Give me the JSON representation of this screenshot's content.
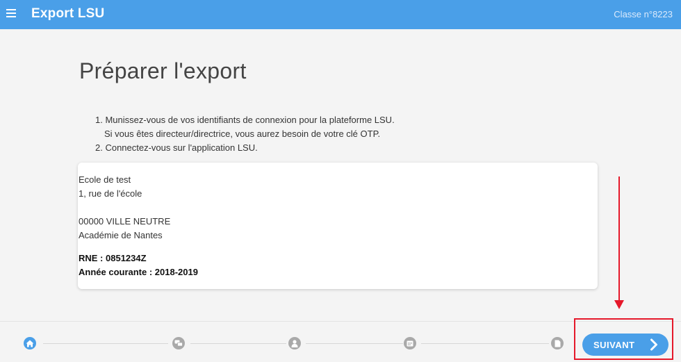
{
  "header": {
    "menu_icon": "hamburger-menu-icon",
    "title": "Export LSU",
    "class_label": "Classe n°8223"
  },
  "main": {
    "title": "Préparer l'export",
    "instructions": [
      "1. Munissez-vous de vos identifiants de connexion pour la plateforme LSU.",
      "Si vous êtes directeur/directrice, vous aurez besoin de votre clé OTP.",
      "2. Connectez-vous sur l'application LSU."
    ],
    "school": {
      "name": "Ecole de test",
      "address": "1, rue de l'école",
      "city": "00000 VILLE NEUTRE",
      "academy": "Académie de Nantes",
      "rne": "RNE : 0851234Z",
      "year": "Année courante : 2018-2019"
    }
  },
  "footer": {
    "steps": [
      {
        "icon": "home-icon",
        "active": true
      },
      {
        "icon": "classes-icon",
        "active": false
      },
      {
        "icon": "user-icon",
        "active": false
      },
      {
        "icon": "calendar-icon",
        "active": false
      },
      {
        "icon": "document-icon",
        "active": false
      }
    ],
    "next_label": "SUIVANT",
    "next_icon": "chevron-right-icon"
  },
  "colors": {
    "primary": "#4a9fe8",
    "step_inactive": "#a9a9a9",
    "annotation": "#e5182a"
  }
}
